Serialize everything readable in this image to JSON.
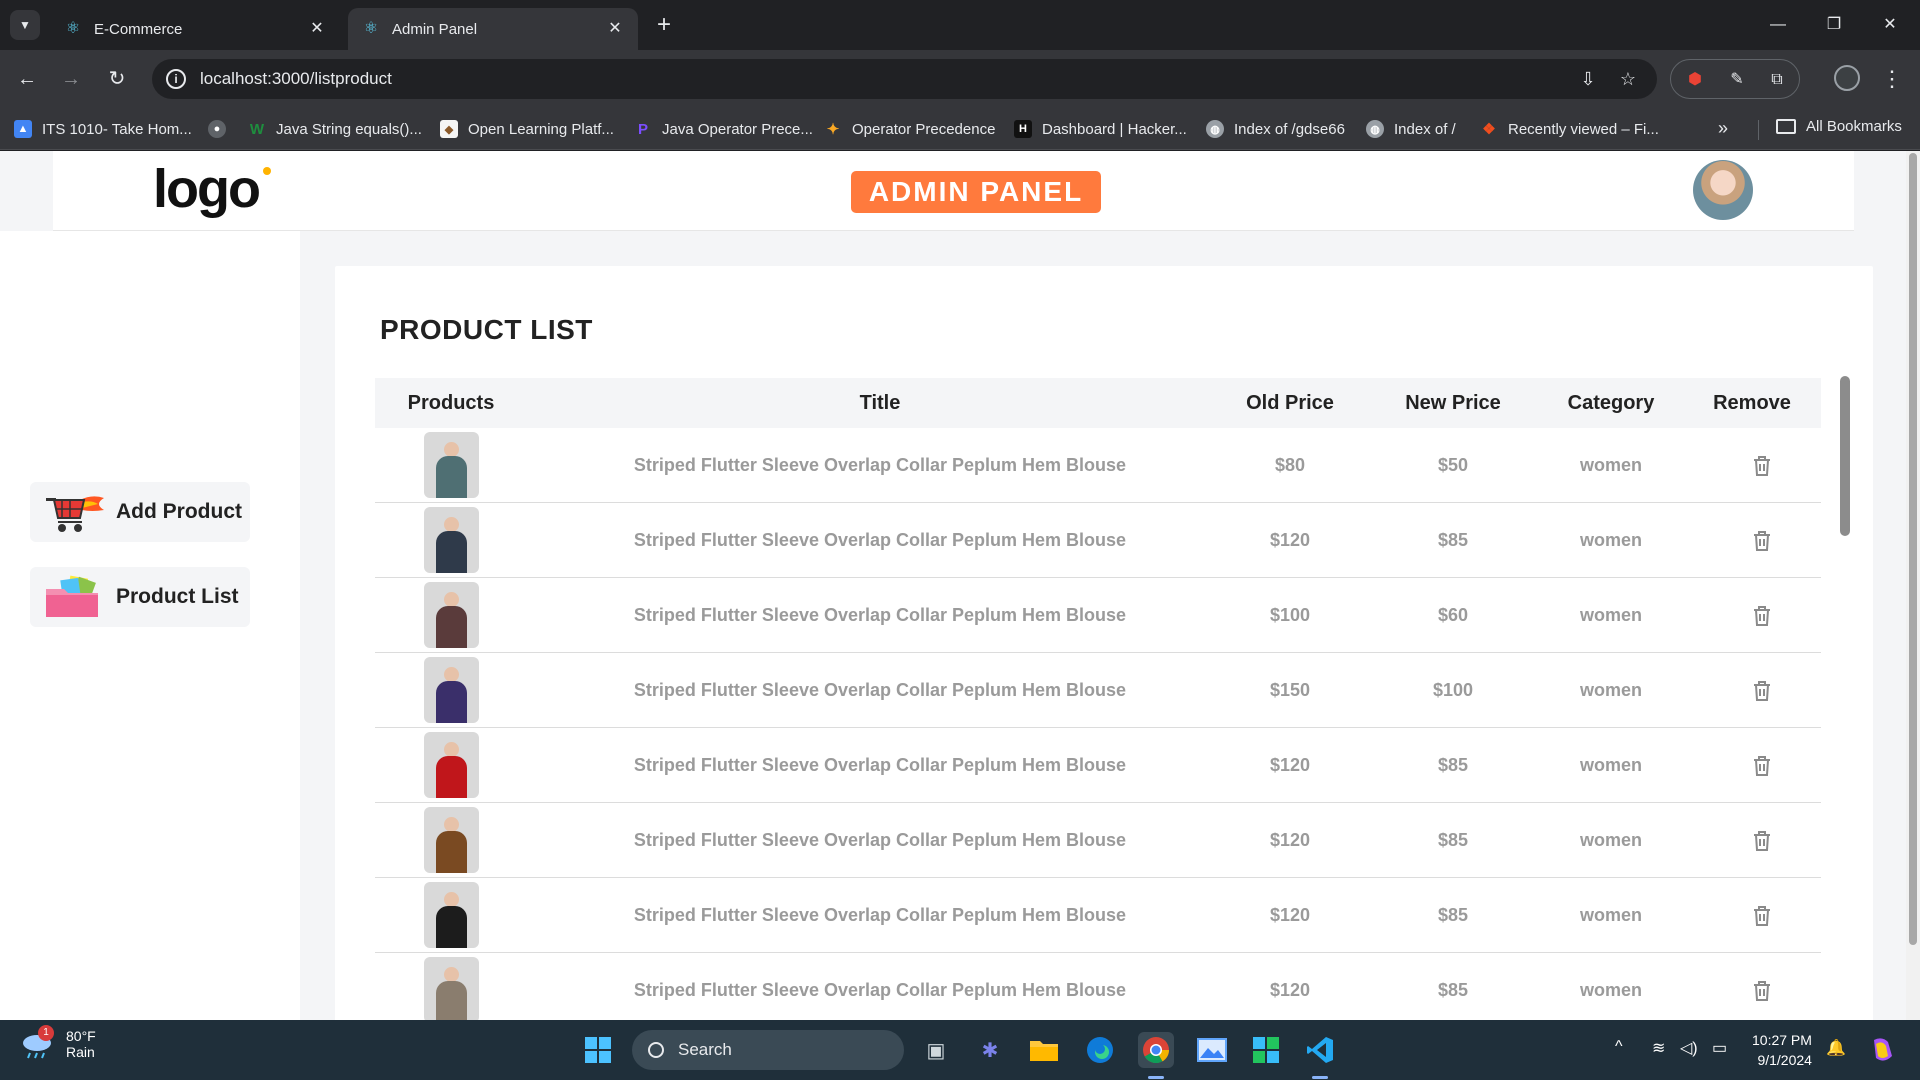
{
  "browser": {
    "tabs": [
      {
        "label": "E-Commerce",
        "active": false
      },
      {
        "label": "Admin Panel",
        "active": true
      }
    ],
    "url": "localhost:3000/listproduct",
    "bookmarks": [
      {
        "label": "ITS 1010- Take Hom...",
        "color": "#4285f4"
      },
      {
        "label": "",
        "color": "#5f6368"
      },
      {
        "label": "Java String equals()...",
        "color": "#1e8e3e"
      },
      {
        "label": "Open Learning Platf...",
        "color": "#8b5a2b"
      },
      {
        "label": "Java Operator Prece...",
        "color": "#7c4dff"
      },
      {
        "label": "Operator Precedence",
        "color": "#f9a825"
      },
      {
        "label": "Dashboard | Hacker...",
        "color": "#111111"
      },
      {
        "label": "Index of /gdse66",
        "color": "#9aa0a6"
      },
      {
        "label": "Index of /",
        "color": "#9aa0a6"
      },
      {
        "label": "Recently viewed – Fi...",
        "color": "#f24e1e"
      }
    ],
    "all_bookmarks": "All Bookmarks"
  },
  "navbar": {
    "logo": "logo",
    "badge": "ADMIN PANEL"
  },
  "sidebar": {
    "items": [
      {
        "label": "Add Product"
      },
      {
        "label": "Product List"
      }
    ]
  },
  "product_list": {
    "title": "PRODUCT LIST",
    "columns": [
      "Products",
      "Title",
      "Old Price",
      "New Price",
      "Category",
      "Remove"
    ],
    "rows": [
      {
        "title": "Striped Flutter Sleeve Overlap Collar Peplum Hem Blouse",
        "old_price": "$80",
        "new_price": "$50",
        "category": "women",
        "color": "#4f6f73"
      },
      {
        "title": "Striped Flutter Sleeve Overlap Collar Peplum Hem Blouse",
        "old_price": "$120",
        "new_price": "$85",
        "category": "women",
        "color": "#2f3a4a"
      },
      {
        "title": "Striped Flutter Sleeve Overlap Collar Peplum Hem Blouse",
        "old_price": "$100",
        "new_price": "$60",
        "category": "women",
        "color": "#5a3b3b"
      },
      {
        "title": "Striped Flutter Sleeve Overlap Collar Peplum Hem Blouse",
        "old_price": "$150",
        "new_price": "$100",
        "category": "women",
        "color": "#3a2f6a"
      },
      {
        "title": "Striped Flutter Sleeve Overlap Collar Peplum Hem Blouse",
        "old_price": "$120",
        "new_price": "$85",
        "category": "women",
        "color": "#c0161b"
      },
      {
        "title": "Striped Flutter Sleeve Overlap Collar Peplum Hem Blouse",
        "old_price": "$120",
        "new_price": "$85",
        "category": "women",
        "color": "#7a4a22"
      },
      {
        "title": "Striped Flutter Sleeve Overlap Collar Peplum Hem Blouse",
        "old_price": "$120",
        "new_price": "$85",
        "category": "women",
        "color": "#1c1c1c"
      },
      {
        "title": "Striped Flutter Sleeve Overlap Collar Peplum Hem Blouse",
        "old_price": "$120",
        "new_price": "$85",
        "category": "women",
        "color": "#8a7d6e"
      }
    ]
  },
  "taskbar": {
    "weather_temp": "80°F",
    "weather_desc": "Rain",
    "weather_badge": "1",
    "search": "Search",
    "time": "10:27 PM",
    "date": "9/1/2024"
  },
  "colors": {
    "accent": "#ff7a3d",
    "cell_text": "#9a9a9a"
  }
}
